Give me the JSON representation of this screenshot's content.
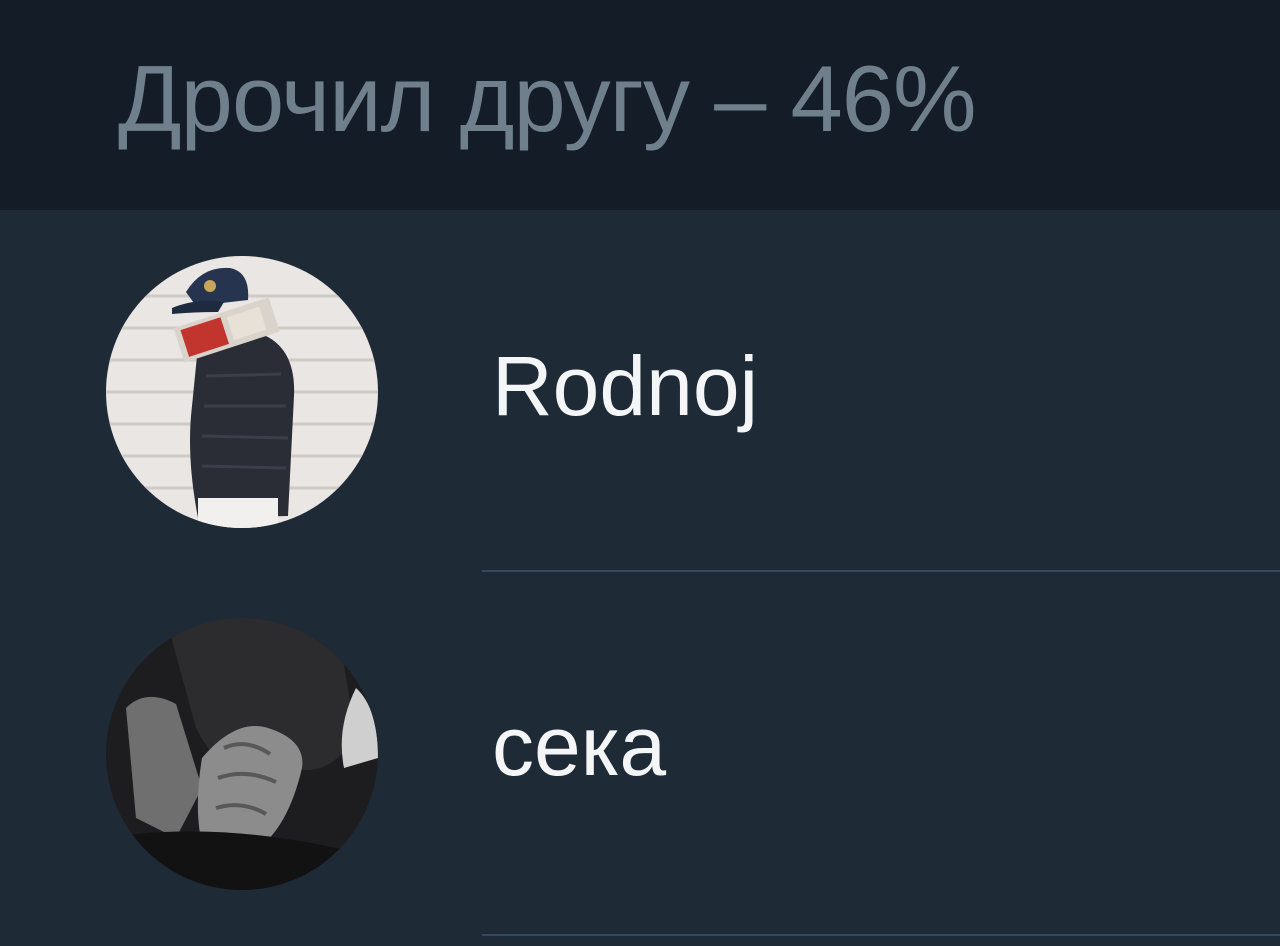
{
  "poll": {
    "option_label": "Дрочил другу – 46%"
  },
  "voters": [
    {
      "name": "Rodnoj",
      "avatar_icon": "avatar-photo-cap-jacket"
    },
    {
      "name": "сека",
      "avatar_icon": "avatar-photo-covering-face"
    }
  ],
  "colors": {
    "header_bg": "#141d27",
    "list_bg": "#1f2a37",
    "title_text": "#707f8c",
    "name_text": "#f3f5f7",
    "divider": "#334a61"
  }
}
